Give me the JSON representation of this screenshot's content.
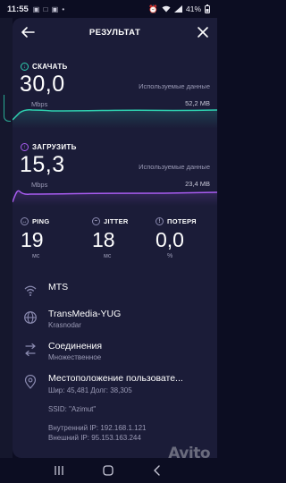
{
  "status": {
    "time": "11:55",
    "left_icons": "▣ □ ▣ •",
    "battery": "41%"
  },
  "header": {
    "title": "РЕЗУЛЬТАТ"
  },
  "download": {
    "label": "СКАЧАТЬ",
    "value": "30,0",
    "unit": "Mbps",
    "used_label": "Используемые данные",
    "used_value": "52,2 MB",
    "color": "#2fd1b0"
  },
  "upload": {
    "label": "ЗАГРУЗИТЬ",
    "value": "15,3",
    "unit": "Mbps",
    "used_label": "Используемые данные",
    "used_value": "23,4 MB",
    "color": "#a85cf0"
  },
  "stats": {
    "ping": {
      "label": "PING",
      "value": "19",
      "unit": "мс"
    },
    "jitter": {
      "label": "JITTER",
      "value": "18",
      "unit": "мс"
    },
    "loss": {
      "label": "ПОТЕРЯ",
      "value": "0,0",
      "unit": "%"
    }
  },
  "info": {
    "network": {
      "name": "MTS",
      "icon": "wifi-icon"
    },
    "provider": {
      "name": "TransMedia-YUG",
      "city": "Krasnodar",
      "icon": "globe-icon"
    },
    "connections": {
      "title": "Соединения",
      "value": "Множественное",
      "icon": "connections-icon"
    },
    "location": {
      "title": "Местоположение пользовате...",
      "coords": "Шир: 45,481 Долг: 38,305",
      "ssid": "SSID: \"Azimut\"",
      "internal_ip": "Внутренний IP: 192.168.1.121",
      "external_ip": "Внешний IP: 95.153.163.244",
      "icon": "location-pin-icon"
    }
  },
  "watermark": "Avito"
}
